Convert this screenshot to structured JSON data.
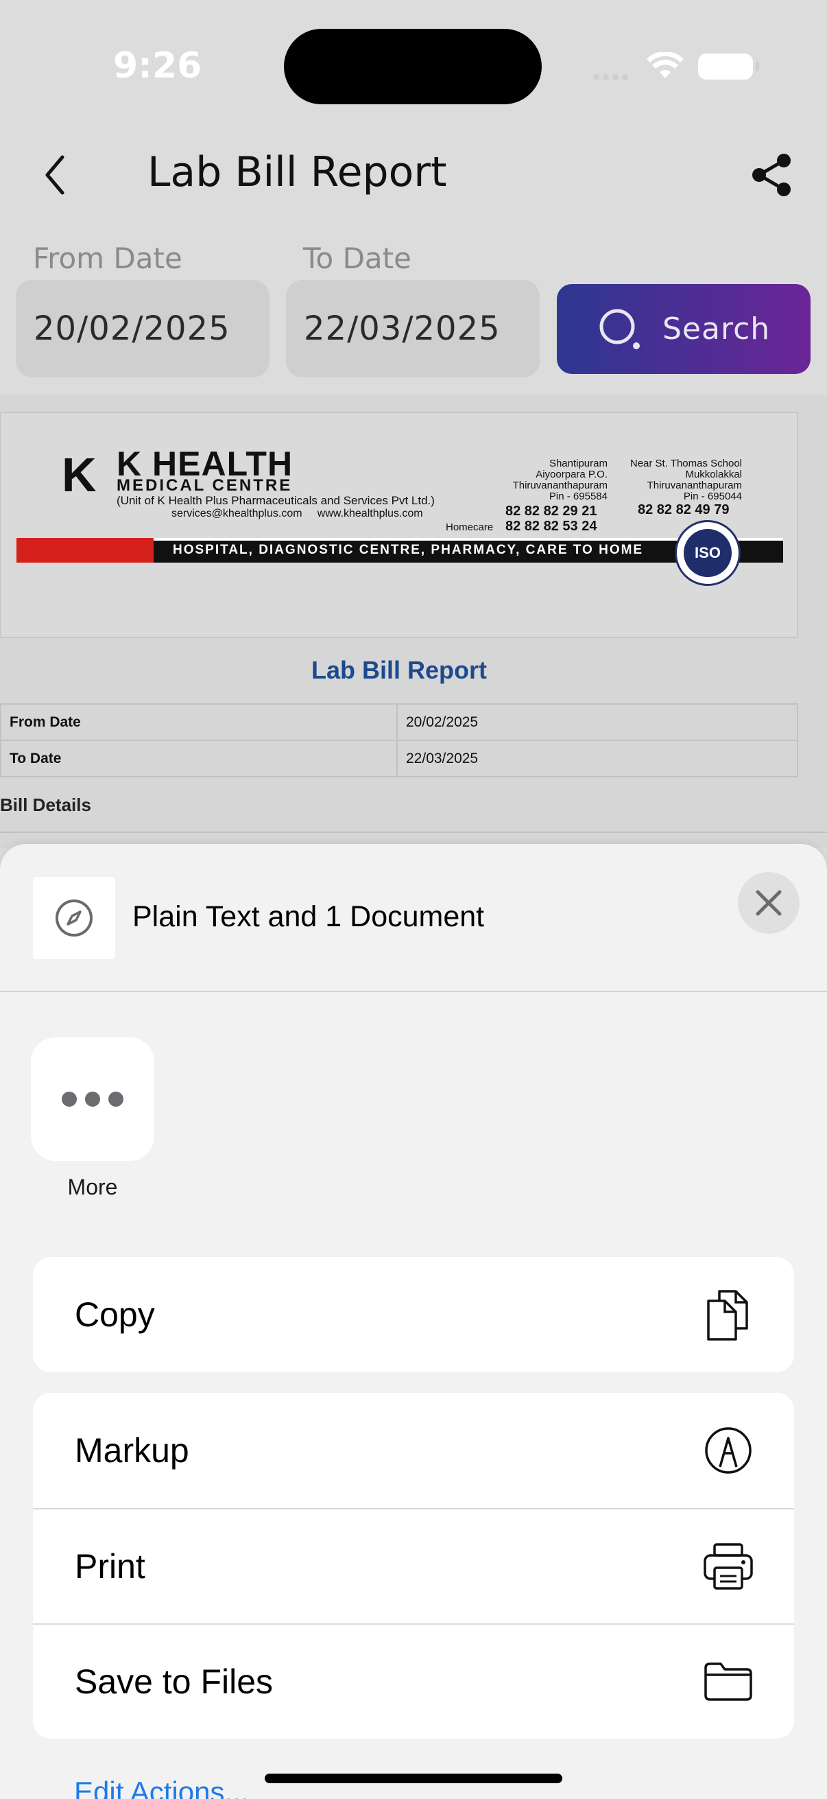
{
  "status_bar": {
    "time": "9:26"
  },
  "nav": {
    "title": "Lab Bill Report"
  },
  "filters": {
    "from_label": "From Date",
    "from_value": "20/02/2025",
    "to_label": "To Date",
    "to_value": "22/03/2025",
    "search_label": "Search"
  },
  "letterhead": {
    "logo_letter": "K",
    "name": "K HEALTH",
    "subtitle": "MEDICAL CENTRE",
    "unit": "(Unit of K Health Plus Pharmaceuticals and Services Pvt Ltd.)",
    "email": "services@khealthplus.com",
    "website": "www.khealthplus.com",
    "address1": [
      "Shantipuram",
      "Aiyoorpara P.O.",
      "Thiruvananthapuram",
      "Pin - 695584"
    ],
    "address2": [
      "Near St. Thomas School",
      "Mukkolakkal",
      "Thiruvananthapuram",
      "Pin - 695044"
    ],
    "phone1": "82 82 82 29 21",
    "phone2": "82 82 82 49 79",
    "homecare_label": "Homecare",
    "homecare_phone": "82 82 82 53 24",
    "tagline": "HOSPITAL, DIAGNOSTIC CENTRE, PHARMACY, CARE TO HOME",
    "seal": "ISO"
  },
  "report": {
    "title": "Lab Bill Report",
    "rows": [
      {
        "label": "From Date",
        "value": "20/02/2025"
      },
      {
        "label": "To Date",
        "value": "22/03/2025"
      }
    ],
    "section": "Bill Details"
  },
  "share_sheet": {
    "title": "Plain Text and 1 Document",
    "more_label": "More",
    "actions": [
      {
        "label": "Copy",
        "icon": "copy-icon"
      },
      {
        "label": "Markup",
        "icon": "markup-icon"
      },
      {
        "label": "Print",
        "icon": "printer-icon"
      },
      {
        "label": "Save to Files",
        "icon": "folder-icon"
      }
    ],
    "edit_actions": "Edit Actions..."
  },
  "colors": {
    "search_gradient_start": "#2d3791",
    "search_gradient_end": "#6a2596",
    "report_title": "#1d4a8e",
    "link_blue": "#1f7ae6"
  }
}
